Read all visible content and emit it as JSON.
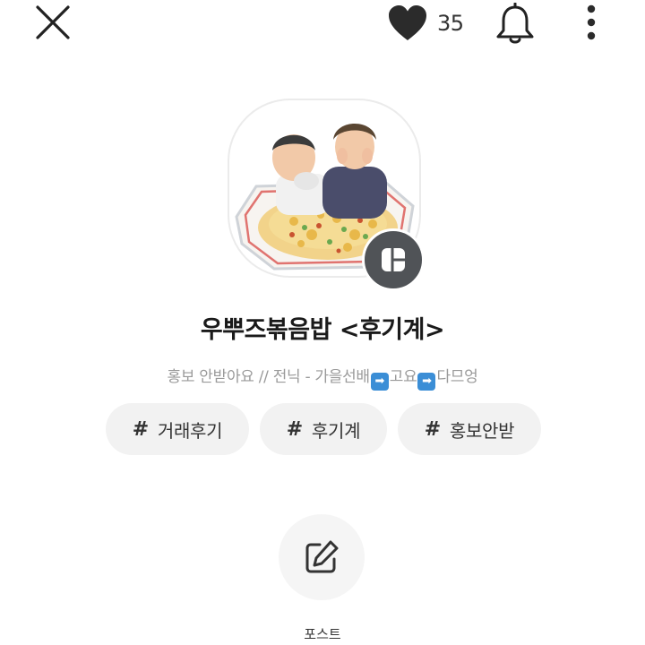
{
  "header": {
    "like_count": "35",
    "icons": [
      "close-icon",
      "heart-icon",
      "bell-icon",
      "more-vertical-icon"
    ]
  },
  "profile": {
    "title": "우뿌즈볶음밥 <후기계>",
    "description_parts": [
      "홍보 안받아요 // 전닉 - 가을선배",
      "고요",
      "다므엉"
    ],
    "arrow_glyph": "➡",
    "badge_icon": "layout-icon"
  },
  "tags": [
    {
      "hash": "#",
      "label": "거래후기"
    },
    {
      "hash": "#",
      "label": "후기계"
    },
    {
      "hash": "#",
      "label": "홍보안받"
    }
  ],
  "post": {
    "label": "포스트",
    "icon": "edit-icon"
  },
  "colors": {
    "heart": "#2b2b2b",
    "badge_bg": "#505357",
    "tag_bg": "#f2f2f2",
    "arrow_bg": "#3b8ed6"
  }
}
